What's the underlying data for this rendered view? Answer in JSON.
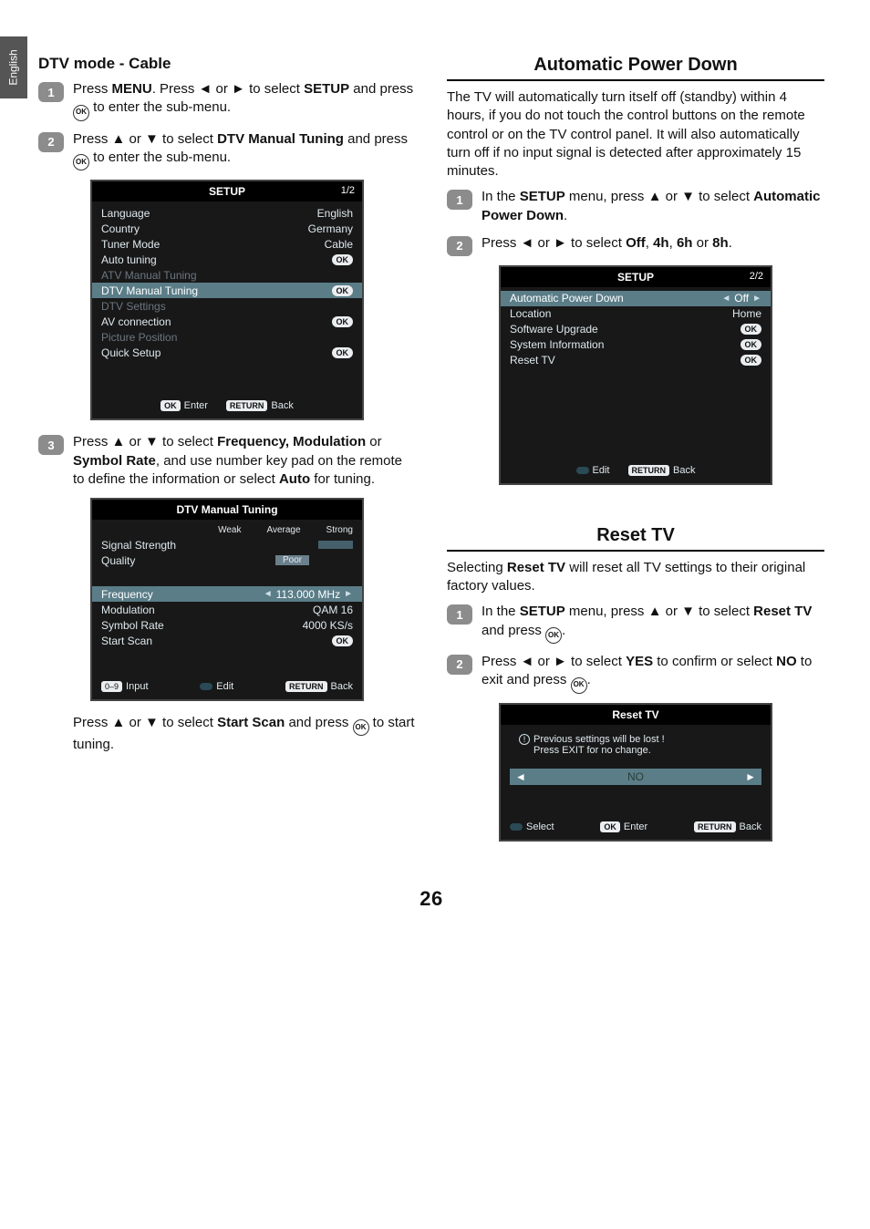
{
  "lang_tab": "English",
  "page_number": "26",
  "left": {
    "heading": "DTV mode - Cable",
    "step1_pre": "Press ",
    "step1_menu": "MENU",
    "step1_mid": ". Press ◄ or ► to select ",
    "step1_setup": "SETUP",
    "step1_after": " and press ",
    "step1_end": " to enter  the sub-menu.",
    "step2_pre": "Press ▲ or ▼ to select ",
    "step2_bold": "DTV Manual Tuning",
    "step2_after": " and press ",
    "step2_end": " to enter the sub-menu.",
    "step3_pre": "Press ▲ or ▼ to select ",
    "step3_b1": "Frequency, Modulation",
    "step3_or": " or ",
    "step3_b2": "Symbol Rate",
    "step3_mid": ", and use number key pad on the remote to define the information or select ",
    "step3_auto": "Auto",
    "step3_end": " for tuning.",
    "final_pre": "Press ▲ or ▼ to select ",
    "final_bold": "Start Scan",
    "final_after": " and press ",
    "final_end": " to start tuning."
  },
  "osd_setup": {
    "title": "SETUP",
    "page": "1/2",
    "rows": [
      {
        "lbl": "Language",
        "val": "English",
        "dim": false
      },
      {
        "lbl": "Country",
        "val": "Germany",
        "dim": false
      },
      {
        "lbl": "Tuner Mode",
        "val": "Cable",
        "dim": false
      },
      {
        "lbl": "Auto tuning",
        "val": "OK",
        "ok": true,
        "dim": false
      },
      {
        "lbl": "ATV Manual Tuning",
        "val": "",
        "dim": true
      },
      {
        "lbl": "DTV Manual Tuning",
        "val": "OK",
        "ok": true,
        "dim": false,
        "selected": true
      },
      {
        "lbl": "DTV Settings",
        "val": "",
        "dim": true
      },
      {
        "lbl": "AV connection",
        "val": "OK",
        "ok": true,
        "dim": false
      },
      {
        "lbl": "Picture Position",
        "val": "",
        "dim": true
      },
      {
        "lbl": "Quick Setup",
        "val": "OK",
        "ok": true,
        "dim": false
      }
    ],
    "footer_enter": "Enter",
    "footer_back": "Back",
    "footer_ok": "OK",
    "footer_return": "RETURN"
  },
  "osd_tuning": {
    "title": "DTV Manual Tuning",
    "sig_label": "Signal Strength",
    "headers": {
      "weak": "Weak",
      "avg": "Average",
      "strong": "Strong"
    },
    "quality_label": "Quality",
    "quality_val": "Poor",
    "rows": [
      {
        "lbl": "Frequency",
        "val": "113.000 MHz",
        "arrows": true,
        "selected": true
      },
      {
        "lbl": "Modulation",
        "val": "QAM 16"
      },
      {
        "lbl": "Symbol Rate",
        "val": "4000 KS/s"
      },
      {
        "lbl": "Start Scan",
        "val": "OK",
        "ok": true
      }
    ],
    "footer_input_key": "0–9",
    "footer_input": "Input",
    "footer_edit": "Edit",
    "footer_back": "Back",
    "footer_return": "RETURN"
  },
  "right": {
    "apd_header": "Automatic Power Down",
    "apd_body": "The TV will automatically turn itself off (standby) within 4 hours, if you do not touch the control buttons on the remote control or on the TV control panel. It will also automatically turn off if no input signal is detected after approximately 15 minutes.",
    "apd_step1_pre": "In the ",
    "apd_step1_setup": "SETUP",
    "apd_step1_mid": " menu, press ▲ or ▼ to select ",
    "apd_step1_bold": "Automatic Power Down",
    "apd_step1_end": ".",
    "apd_step2_pre": "Press ◄ or ► to select ",
    "apd_step2_off": "Off",
    "apd_c": ", ",
    "apd_4h": "4h",
    "apd_6h": "6h",
    "apd_or": " or ",
    "apd_8h": "8h",
    "apd_end": ".",
    "reset_header": "Reset TV",
    "reset_body_pre": "Selecting ",
    "reset_body_bold": "Reset TV",
    "reset_body_end": " will reset all TV settings to their original factory values.",
    "reset_step1_pre": "In the ",
    "reset_step1_setup": "SETUP",
    "reset_step1_mid": " menu, press ▲ or ▼ to select ",
    "reset_step1_bold": "Reset TV",
    "reset_step1_after": " and press ",
    "reset_step1_end": ".",
    "reset_step2_pre": "Press ◄ or ► to select ",
    "reset_step2_yes": "YES",
    "reset_step2_mid": " to confirm or select ",
    "reset_step2_no": "NO",
    "reset_step2_after": " to exit and press ",
    "reset_step2_end": "."
  },
  "osd_apd": {
    "title": "SETUP",
    "page": "2/2",
    "rows": [
      {
        "lbl": "Automatic Power Down",
        "val": "Off",
        "arrows": true,
        "selected": true
      },
      {
        "lbl": "Location",
        "val": "Home"
      },
      {
        "lbl": "Software Upgrade",
        "val": "OK",
        "ok": true
      },
      {
        "lbl": "System Information",
        "val": "OK",
        "ok": true
      },
      {
        "lbl": "Reset TV",
        "val": "OK",
        "ok": true
      }
    ],
    "footer_edit": "Edit",
    "footer_back": "Back",
    "footer_return": "RETURN"
  },
  "osd_reset": {
    "title": "Reset TV",
    "msg_line1": "Previous settings will be lost !",
    "msg_line2": "Press EXIT for no change.",
    "choice": "NO",
    "footer_select": "Select",
    "footer_enter": "Enter",
    "footer_back": "Back",
    "footer_ok": "OK",
    "footer_return": "RETURN"
  },
  "step_numbers": {
    "s1": "1",
    "s2": "2",
    "s3": "3"
  },
  "ok_glyph": "OK"
}
